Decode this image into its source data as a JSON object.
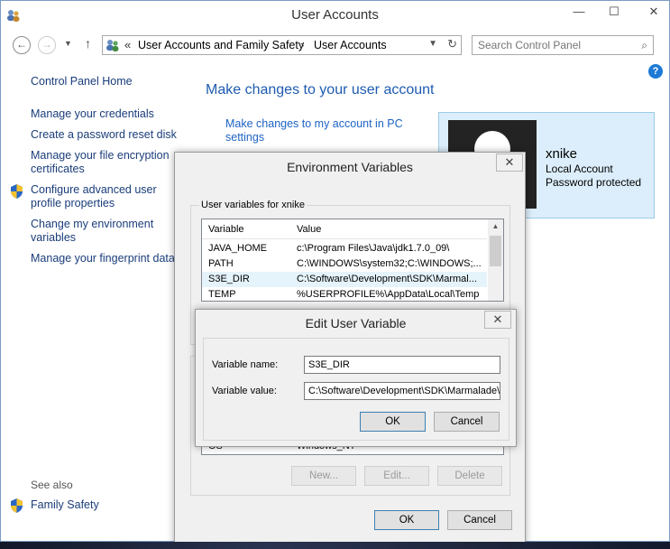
{
  "window": {
    "title": "User Accounts",
    "min_glyph": "—",
    "max_glyph": "☐",
    "close_glyph": "✕"
  },
  "nav": {
    "back_glyph": "←",
    "forward_glyph": "→",
    "history_glyph": "▼",
    "up_glyph": "↑",
    "breadcrumb_prefix": "«",
    "breadcrumb": [
      "User Accounts and Family Safety",
      "User Accounts"
    ],
    "breadcrumb_sep": "›",
    "dropdown_glyph": "▼",
    "refresh_glyph": "↻",
    "search_placeholder": "Search Control Panel",
    "search_glyph": "⌕",
    "help_glyph": "?"
  },
  "sidebar": {
    "home": "Control Panel Home",
    "links": [
      "Manage your credentials",
      "Create a password reset disk",
      "Manage your file encryption certificates",
      "Configure advanced user profile properties",
      "Change my environment variables",
      "Manage your fingerprint data"
    ],
    "see_also_label": "See also",
    "see_also_links": [
      "Family Safety"
    ]
  },
  "main": {
    "heading": "Make changes to your user account",
    "pc_settings_link": "Make changes to my account in PC settings"
  },
  "user": {
    "name": "xnike",
    "account_type": "Local Account",
    "password_status": "Password protected"
  },
  "env_dialog": {
    "title": "Environment Variables",
    "close_glyph": "✕",
    "user_group_label": "User variables for xnike",
    "columns": [
      "Variable",
      "Value"
    ],
    "user_vars": [
      {
        "name": "JAVA_HOME",
        "value": "c:\\Program Files\\Java\\jdk1.7.0_09\\"
      },
      {
        "name": "PATH",
        "value": "C:\\WINDOWS\\system32;C:\\WINDOWS;..."
      },
      {
        "name": "S3E_DIR",
        "value": "C:\\Software\\Development\\SDK\\Marmal..."
      },
      {
        "name": "TEMP",
        "value": "%USERPROFILE%\\AppData\\Local\\Temp"
      }
    ],
    "system_vars_visible": [
      {
        "name": "OS",
        "value": "Windows_NT"
      }
    ],
    "system_new": "New...",
    "system_edit": "Edit...",
    "system_delete": "Delete",
    "ok": "OK",
    "cancel": "Cancel"
  },
  "edit_dialog": {
    "title": "Edit User Variable",
    "close_glyph": "✕",
    "name_label": "Variable name:",
    "value_label": "Variable value:",
    "name_value": "S3E_DIR",
    "value_value": "C:\\Software\\Development\\SDK\\Marmalade\\",
    "ok": "OK",
    "cancel": "Cancel"
  },
  "colors": {
    "link": "#1a3d7a",
    "heading": "#1e5bb0",
    "user_card_bg": "#dceefb",
    "help_blue": "#1e7ad6"
  }
}
